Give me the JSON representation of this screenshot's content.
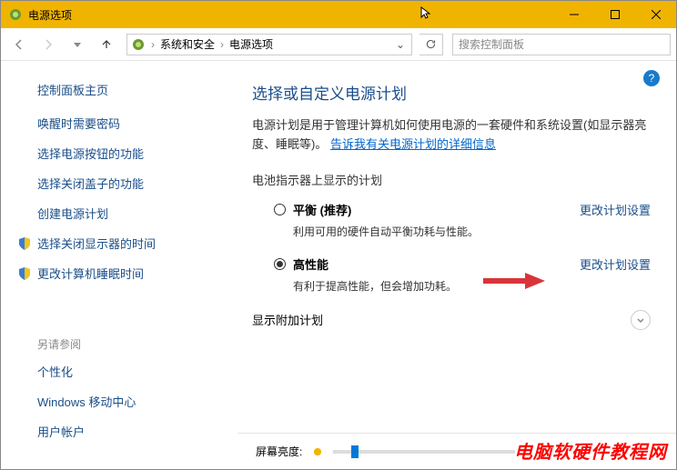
{
  "titlebar": {
    "title": "电源选项"
  },
  "breadcrumb": {
    "part1": "系统和安全",
    "part2": "电源选项"
  },
  "search": {
    "placeholder": "搜索控制面板"
  },
  "sidebar": {
    "home": "控制面板主页",
    "links": {
      "wake_password": "唤醒时需要密码",
      "power_button": "选择电源按钮的功能",
      "close_lid": "选择关闭盖子的功能",
      "create_plan": "创建电源计划",
      "display_off": "选择关闭显示器的时间",
      "sleep_time": "更改计算机睡眠时间"
    },
    "see_also_head": "另请参阅",
    "see_also": {
      "personalization": "个性化",
      "mobility": "Windows 移动中心",
      "accounts": "用户帐户"
    }
  },
  "main": {
    "title": "选择或自定义电源计划",
    "desc_prefix": "电源计划是用于管理计算机如何使用电源的一套硬件和系统设置(如显示器亮度、睡眠等)。",
    "desc_link": "告诉我有关电源计划的详细信息",
    "plans_on_meter_head": "电池指示器上显示的计划",
    "plan_balanced": {
      "label": "平衡 (推荐)",
      "desc": "利用可用的硬件自动平衡功耗与性能。",
      "change": "更改计划设置"
    },
    "plan_high": {
      "label": "高性能",
      "desc": "有利于提高性能，但会增加功耗。",
      "change": "更改计划设置"
    },
    "show_additional": "显示附加计划",
    "brightness_label": "屏幕亮度:"
  },
  "watermark": "电脑软硬件教程网"
}
